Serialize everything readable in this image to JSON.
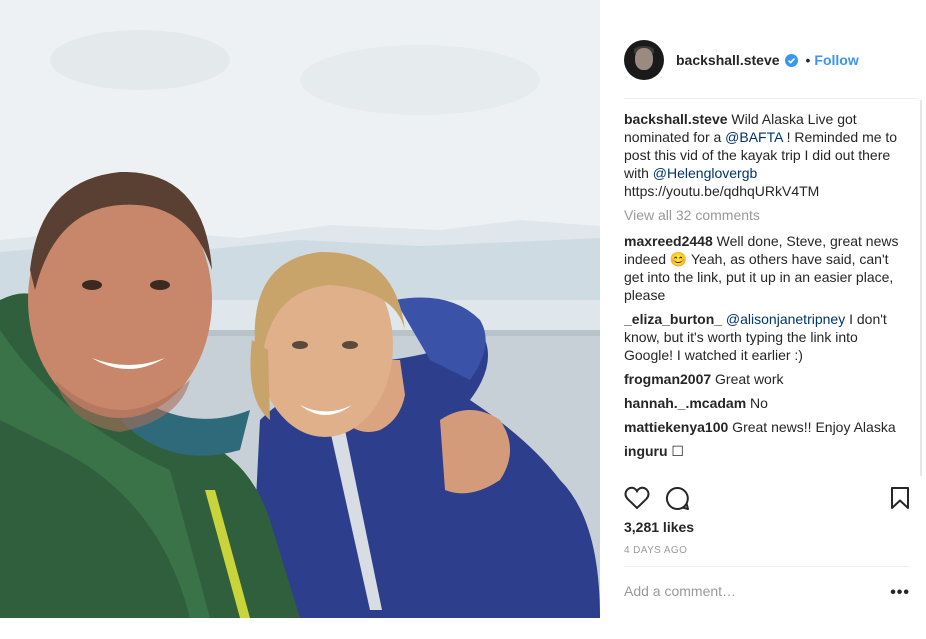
{
  "post": {
    "username": "backshall.steve",
    "follow_label": "Follow",
    "dot": "•",
    "caption": {
      "username": "backshall.steve",
      "text_1": " Wild Alaska Live got nominated for a ",
      "mention_1": "@BAFTA",
      "text_2": " ! Reminded me to post this vid of the kayak trip I did out there with ",
      "mention_2": "@Helenglovergb",
      "text_3": " https://youtu.be/qdhqURkV4TM"
    },
    "view_all": "View all 32 comments",
    "comments": [
      {
        "username": "maxreed2448",
        "text": " Well done, Steve, great news indeed 😊 Yeah, as others have said, can't get into the link, put it up in an easier place, please",
        "mention": ""
      },
      {
        "username": "_eliza_burton_",
        "mention": " @alisonjanetripney",
        "text": " I don't know, but it's worth typing the link into Google! I watched it earlier :)"
      },
      {
        "username": "frogman2007",
        "text": " Great work",
        "mention": ""
      },
      {
        "username": "hannah._.mcadam",
        "text": " No",
        "mention": ""
      },
      {
        "username": "mattiekenya100",
        "text": " Great news!! Enjoy Alaska",
        "mention": ""
      },
      {
        "username": "inguru",
        "text": " ☐",
        "mention": ""
      }
    ],
    "likes": "3,281 likes",
    "time_ago": "4 DAYS AGO",
    "add_comment_placeholder": "Add a comment…",
    "more_label": "•••",
    "icons": {
      "like": "heart-icon",
      "comment": "comment-icon",
      "save": "bookmark-icon",
      "verified": "verified-badge-icon"
    },
    "colors": {
      "link": "#3897f0",
      "mention": "#003569",
      "muted": "#999999"
    }
  }
}
